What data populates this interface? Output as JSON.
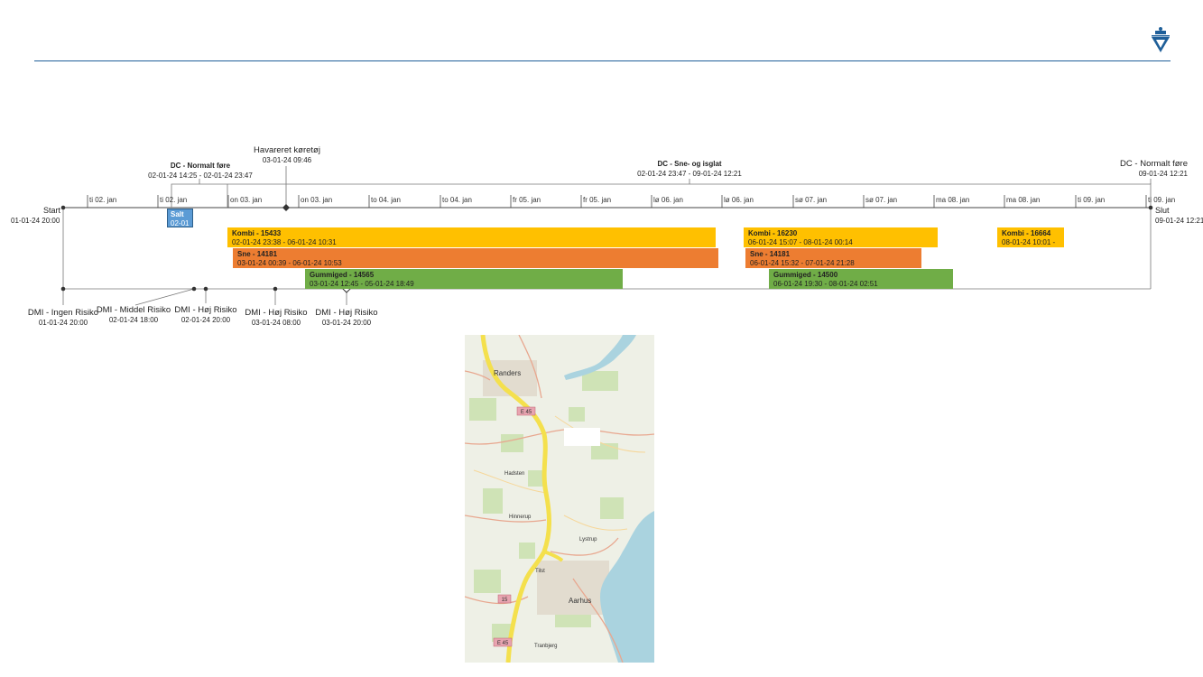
{
  "timeline": {
    "start": {
      "label": "Start",
      "date": "01-01-24 20:00"
    },
    "end": {
      "label": "Slut",
      "date": "09-01-24 12:21"
    },
    "ticks": [
      "ti 02. jan",
      "ti 02. jan",
      "on 03. jan",
      "on 03. jan",
      "to 04. jan",
      "to 04. jan",
      "fr 05. jan",
      "fr 05. jan",
      "lø 06. jan",
      "lø 06. jan",
      "sø 07. jan",
      "sø 07. jan",
      "ma 08. jan",
      "ma 08. jan",
      "ti 09. jan",
      "ti 09. jan"
    ],
    "top_events": [
      {
        "title": "DC - Normalt føre",
        "date": "02-01-24 14:25 - 02-01-24 23:47"
      },
      {
        "title": "Havareret køretøj",
        "date": "03-01-24 09:46"
      },
      {
        "title": "DC - Sne- og isglat",
        "date": "02-01-24 23:47 - 09-01-24 12:21"
      },
      {
        "title": "DC - Normalt føre",
        "date": "09-01-24 12:21"
      }
    ],
    "bars": [
      {
        "title": "Salt",
        "date": "02-01",
        "color": "blue"
      },
      {
        "title": "Kombi - 15433",
        "date": "02-01-24 23:38 - 06-01-24 10:31",
        "color": "yellow"
      },
      {
        "title": "Kombi - 16230",
        "date": "06-01-24 15:07 - 08-01-24 00:14",
        "color": "yellow"
      },
      {
        "title": "Kombi - 16664",
        "date": "08-01-24 10:01 -",
        "color": "yellow"
      },
      {
        "title": "Sne - 14181",
        "date": "03-01-24 00:39 - 06-01-24 10:53",
        "color": "orange"
      },
      {
        "title": "Sne - 14181",
        "date": "06-01-24 15:32 - 07-01-24 21:28",
        "color": "orange"
      },
      {
        "title": "Gummiged - 14565",
        "date": "03-01-24 12:45 - 05-01-24 18:49",
        "color": "green"
      },
      {
        "title": "Gummiged - 14500",
        "date": "06-01-24 19:30 - 08-01-24 02:51",
        "color": "green"
      }
    ],
    "bottom_events": [
      {
        "title": "DMI - Ingen Risiko",
        "date": "01-01-24 20:00"
      },
      {
        "title": "DMI - Middel Risiko",
        "date": "02-01-24 18:00"
      },
      {
        "title": "DMI - Høj Risiko",
        "date": "02-01-24 20:00"
      },
      {
        "title": "DMI - Høj Risiko",
        "date": "03-01-24 08:00"
      },
      {
        "title": "DMI - Høj Risiko",
        "date": "03-01-24 20:00"
      }
    ]
  },
  "map": {
    "places": [
      "Randers",
      "Hadsten",
      "Hinnerup",
      "Lystrup",
      "Tilst",
      "Aarhus",
      "Tranbjerg"
    ],
    "road_shields": [
      "E 45",
      "15",
      "E 45"
    ]
  },
  "colors": {
    "accent_line": "#1f5f99",
    "yellow": "#ffc000",
    "orange": "#ed7d31",
    "green": "#70ad47",
    "blue": "#5b9bd5"
  }
}
